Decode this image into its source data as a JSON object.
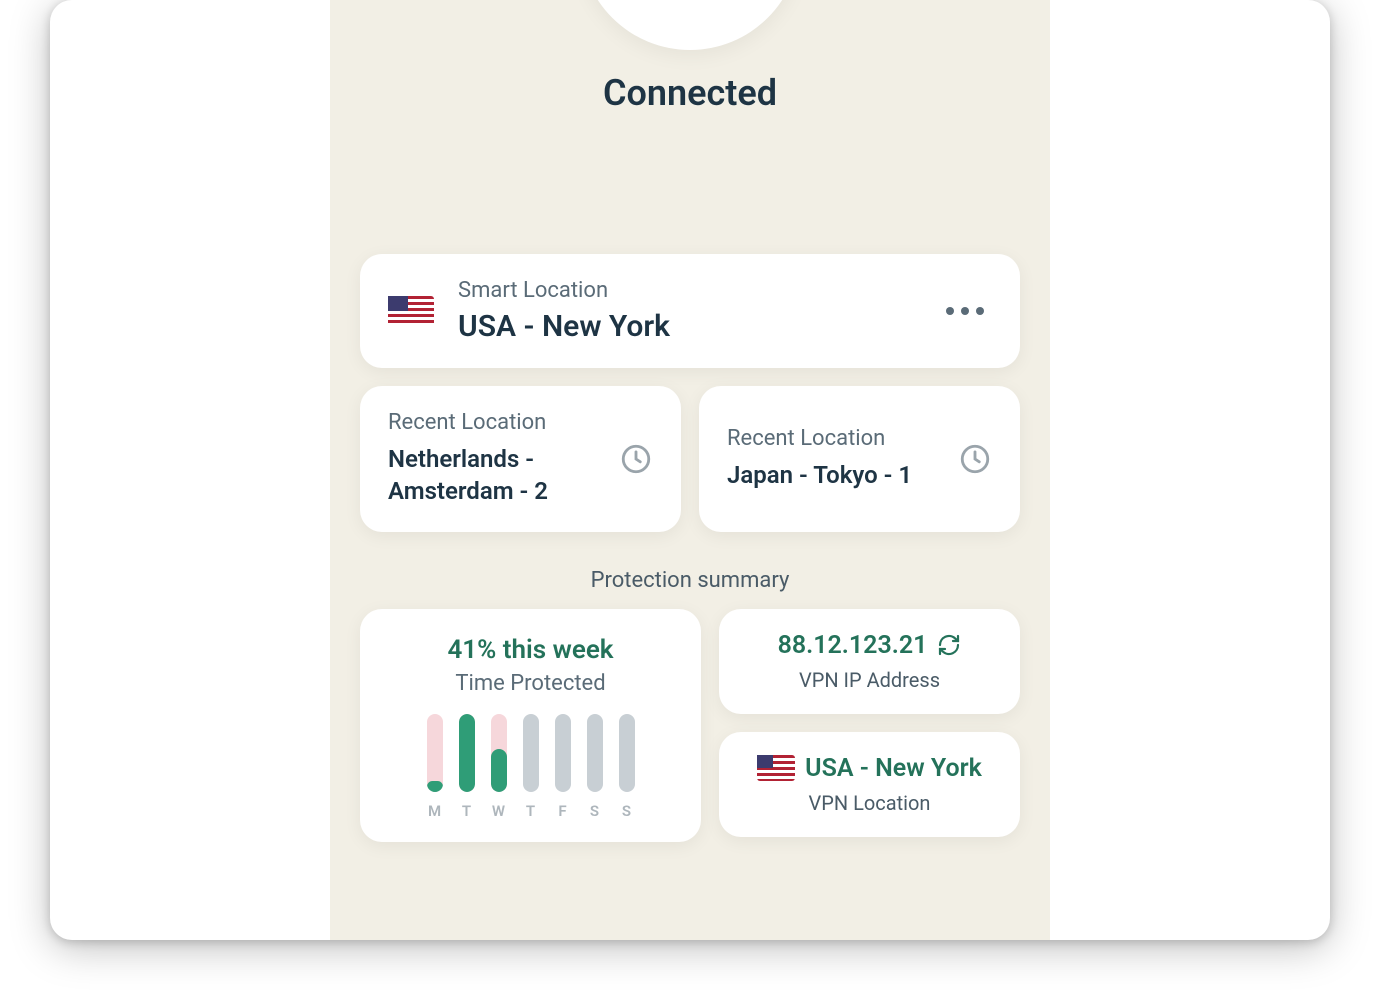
{
  "status": {
    "title": "Connected"
  },
  "smart": {
    "label": "Smart Location",
    "location": "USA - New York"
  },
  "recent": [
    {
      "label": "Recent Location",
      "location": "Netherlands - Amsterdam - 2"
    },
    {
      "label": "Recent Location",
      "location": "Japan - Tokyo - 1"
    }
  ],
  "protection": {
    "title": "Protection summary",
    "percent_label": "41% this week",
    "subtitle": "Time Protected",
    "ip": {
      "value": "88.12.123.21",
      "label": "VPN IP Address"
    },
    "loc": {
      "value": "USA - New York",
      "label": "VPN Location"
    }
  },
  "chart_data": {
    "type": "bar",
    "title": "Time Protected",
    "categories": [
      "M",
      "T",
      "W",
      "T",
      "F",
      "S",
      "S"
    ],
    "series": [
      {
        "name": "protected_pct",
        "values": [
          14,
          100,
          55,
          0,
          0,
          0,
          0
        ]
      },
      {
        "name": "track_type",
        "values": [
          "pink",
          "pink",
          "pink",
          "gray",
          "gray",
          "gray",
          "gray"
        ]
      }
    ],
    "ylim": [
      0,
      100
    ],
    "xlabel": "",
    "ylabel": "",
    "colors": {
      "track_pink": "#f6d7db",
      "track_gray": "#c8cfd4",
      "fill": "#2f9d77"
    }
  }
}
